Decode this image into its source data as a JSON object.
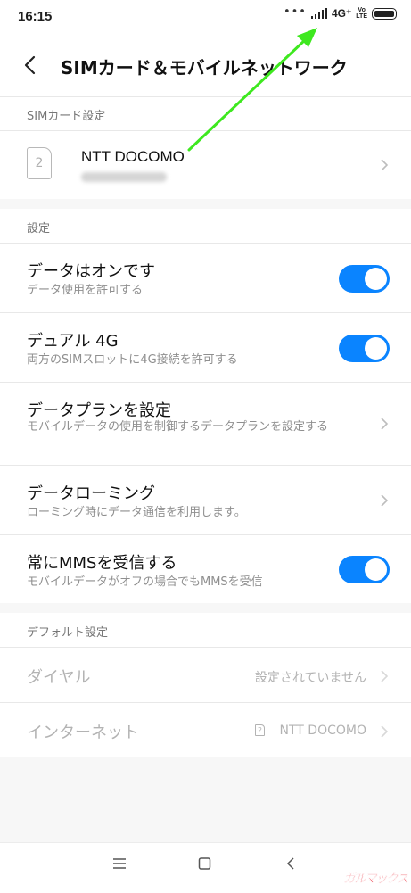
{
  "status_bar": {
    "time": "16:15",
    "dots": "•••",
    "network": "4G⁺",
    "volte_top": "Vo",
    "volte_bottom": "LTE"
  },
  "header": {
    "title": "SIMカード＆モバイルネットワーク"
  },
  "sim_section": {
    "label": "SIMカード設定",
    "sim_slot": "2",
    "carrier": "NTT DOCOMO"
  },
  "settings_section": {
    "label": "設定",
    "rows": [
      {
        "title": "データはオンです",
        "subtitle": "データ使用を許可する",
        "control": "toggle",
        "on": true
      },
      {
        "title": "デュアル 4G",
        "subtitle": "両方のSIMスロットに4G接続を許可する",
        "control": "toggle",
        "on": true
      },
      {
        "title": "データプランを設定",
        "subtitle": "モバイルデータの使用を制御するデータプランを設定する",
        "control": "chevron"
      },
      {
        "title": "データローミング",
        "subtitle": "ローミング時にデータ通信を利用します。",
        "control": "chevron"
      },
      {
        "title": "常にMMSを受信する",
        "subtitle": "モバイルデータがオフの場合でもMMSを受信",
        "control": "toggle",
        "on": true
      }
    ]
  },
  "default_section": {
    "label": "デフォルト設定",
    "rows": [
      {
        "title": "ダイヤル",
        "value": "設定されていません"
      },
      {
        "title": "インターネット",
        "sim_slot": "2",
        "value": "NTT DOCOMO"
      }
    ]
  },
  "watermark": "ガルマックス",
  "colors": {
    "accent": "#0a84ff",
    "annotation_arrow": "#3ee81f"
  }
}
